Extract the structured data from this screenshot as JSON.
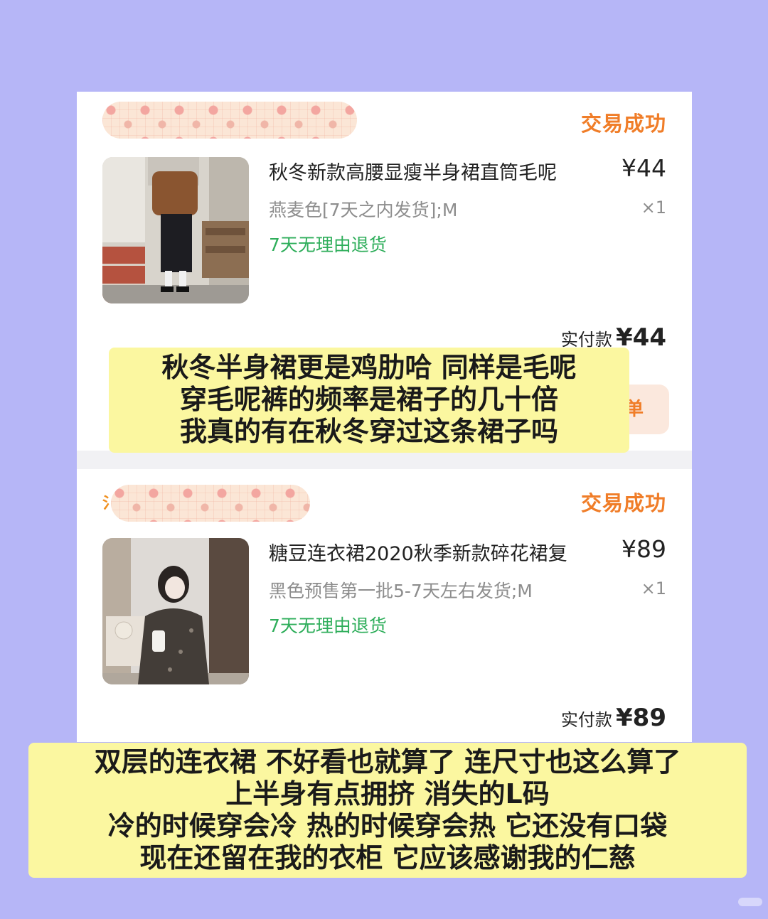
{
  "orders": [
    {
      "status": "交易成功",
      "title": "秋冬新款高腰显瘦半身裙直筒毛呢",
      "price": "¥44",
      "spec": "燕麦色[7天之内发货];M",
      "qty": "×1",
      "return_policy": "7天无理由退货",
      "paid_label": "实付款",
      "paid_amount": "¥44",
      "button_partial": "单"
    },
    {
      "status": "交易成功",
      "title": "糖豆连衣裙2020秋季新款碎花裙复",
      "price": "¥89",
      "spec": "黑色预售第一批5-7天左右发货;M",
      "qty": "×1",
      "return_policy": "7天无理由退货",
      "paid_label": "实付款",
      "paid_amount": "¥89"
    }
  ],
  "notes": {
    "first": [
      "秋冬半身裙更是鸡肋哈 同样是毛呢",
      "穿毛呢裤的频率是裙子的几十倍",
      "我真的有在秋冬穿过这条裙子吗"
    ],
    "second": [
      "双层的连衣裙 不好看也就算了 连尺寸也这么算了",
      "上半身有点拥挤 消失的L码",
      "冷的时候穿会冷 热的时候穿会热 它还没有口袋",
      "现在还留在我的衣柜 它应该感谢我的仁慈"
    ]
  },
  "colors": {
    "background": "#b6b6f7",
    "status": "#f07d28",
    "return_green": "#2fae5b",
    "note_yellow": "#fbf7a0"
  }
}
